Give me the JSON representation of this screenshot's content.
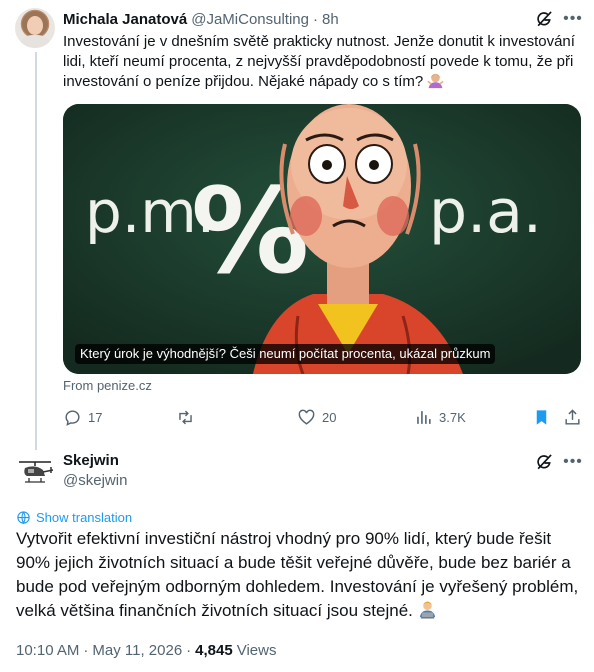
{
  "parent_tweet": {
    "author_name": "Michala Janatová",
    "author_handle": "@JaMiConsulting",
    "separator": "·",
    "time": "8h",
    "text": "Investování je v dnešním světě prakticky nutnost. Jenže donutit k investování lidi, kteří neumí procenta, z nejvyšší pravděpodobností povede k tomu, že při investování o peníze přijdou. Nějaké nápady co s tím?",
    "text_emoji": "woman-shrugging-icon",
    "card": {
      "image_text_left": "p.m.",
      "image_text_center": "%",
      "image_text_right": "p.a.",
      "caption": "Který úrok je výhodnější? Češi neumí počítat procenta, ukázal průzkum",
      "source": "From penize.cz"
    },
    "actions": {
      "reply_count": "17",
      "retweet_count": "",
      "like_count": "20",
      "views_count": "3.7K"
    }
  },
  "main_tweet": {
    "author_name": "Skejwin",
    "author_handle": "@skejwin",
    "translate_label": "Show translation",
    "text": "Vytvořit efektivní investiční nástroj vhodný pro 90% lidí, který bude řešit 90% jejich životních situací a bude těšit veřejné důvěře, bude bez bariér a bude pod veřejným odborným dohledem. Investování je vyřešený problém, velká většina finančních životních situací jsou stejné.",
    "text_emoji": "man-technologist-icon",
    "time": "10:10 AM",
    "date": "May 11, 2026",
    "separator": "·",
    "views_count": "4,845",
    "views_label": "Views"
  },
  "colors": {
    "accent": "#1d9bf0",
    "bookmark_active": "#1d9bf0",
    "secondary_text": "#536471",
    "thread_line": "#cfd9de"
  }
}
